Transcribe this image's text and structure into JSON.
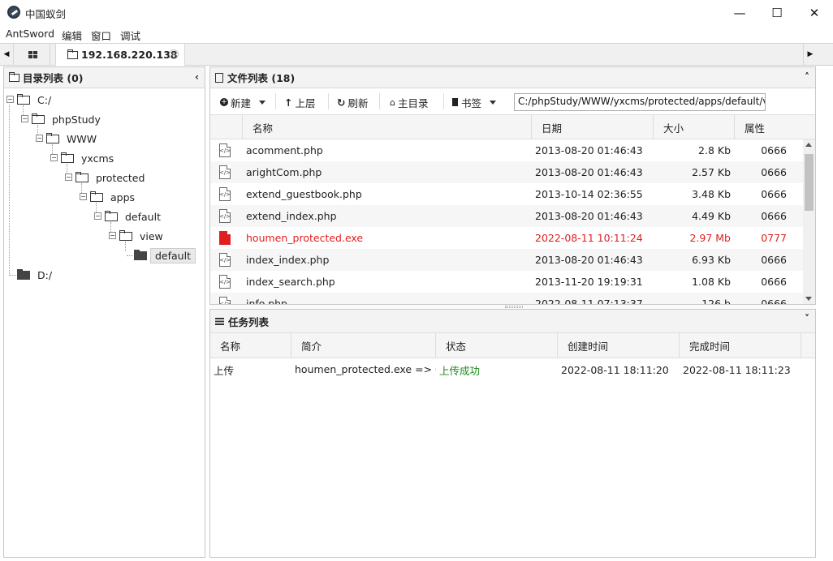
{
  "window": {
    "title": "中国蚁剑",
    "minimize_glyph": "—",
    "maximize_glyph": "☐",
    "close_glyph": "✕"
  },
  "menu": [
    "AntSword",
    "编辑",
    "窗口",
    "调试"
  ],
  "tabs": {
    "left_arrow": "◀",
    "right_arrow": "▶",
    "host_label": "192.168.220.138",
    "close_glyph": "✕"
  },
  "dir_panel": {
    "title": "目录列表 (0)",
    "collapse_glyph": "‹",
    "tree": [
      {
        "label": "C:/",
        "depth": 0,
        "toggle": "−",
        "filled": false,
        "selected": false
      },
      {
        "label": "phpStudy",
        "depth": 1,
        "toggle": "−",
        "filled": false,
        "selected": false
      },
      {
        "label": "WWW",
        "depth": 2,
        "toggle": "−",
        "filled": false,
        "selected": false
      },
      {
        "label": "yxcms",
        "depth": 3,
        "toggle": "−",
        "filled": false,
        "selected": false
      },
      {
        "label": "protected",
        "depth": 4,
        "toggle": "−",
        "filled": false,
        "selected": false
      },
      {
        "label": "apps",
        "depth": 5,
        "toggle": "−",
        "filled": false,
        "selected": false
      },
      {
        "label": "default",
        "depth": 6,
        "toggle": "−",
        "filled": false,
        "selected": false
      },
      {
        "label": "view",
        "depth": 7,
        "toggle": "−",
        "filled": false,
        "selected": false
      },
      {
        "label": "default",
        "depth": 8,
        "toggle": "",
        "filled": true,
        "selected": true
      },
      {
        "label": "D:/",
        "depth": 0,
        "toggle": "",
        "filled": true,
        "selected": false
      }
    ]
  },
  "file_panel": {
    "title": "文件列表 (18)",
    "collapse_glyph": "˄",
    "toolbar": {
      "new_label": "新建",
      "up_label": "上层",
      "refresh_label": "刷新",
      "home_label": "主目录",
      "bookmark_label": "书签",
      "path_value": "C:/phpStudy/WWW/yxcms/protected/apps/default/view/"
    },
    "columns": [
      "名称",
      "日期",
      "大小",
      "属性"
    ],
    "files": [
      {
        "name": "acomment.php",
        "date": "2013-08-20 01:46:43",
        "size": "2.8 Kb",
        "attr": "0666",
        "type": "php"
      },
      {
        "name": "arightCom.php",
        "date": "2013-08-20 01:46:43",
        "size": "2.57 Kb",
        "attr": "0666",
        "type": "php"
      },
      {
        "name": "extend_guestbook.php",
        "date": "2013-10-14 02:36:55",
        "size": "3.48 Kb",
        "attr": "0666",
        "type": "php"
      },
      {
        "name": "extend_index.php",
        "date": "2013-08-20 01:46:43",
        "size": "4.49 Kb",
        "attr": "0666",
        "type": "php"
      },
      {
        "name": "houmen_protected.exe",
        "date": "2022-08-11 10:11:24",
        "size": "2.97 Mb",
        "attr": "0777",
        "type": "exe"
      },
      {
        "name": "index_index.php",
        "date": "2013-08-20 01:46:43",
        "size": "6.93 Kb",
        "attr": "0666",
        "type": "php"
      },
      {
        "name": "index_search.php",
        "date": "2013-11-20 19:19:31",
        "size": "1.08 Kb",
        "attr": "0666",
        "type": "php"
      },
      {
        "name": "info.php",
        "date": "2022-08-11 07:13:37",
        "size": "126 b",
        "attr": "0666",
        "type": "php"
      }
    ]
  },
  "task_panel": {
    "title": "任务列表",
    "collapse_glyph": "˅",
    "columns": [
      "名称",
      "简介",
      "状态",
      "创建时间",
      "完成时间"
    ],
    "tasks": [
      {
        "name": "上传",
        "desc": "houmen_protected.exe => C:/phpStudy/WWW/yxcms/protected/apps/default/view/",
        "status": "上传成功",
        "created": "2022-08-11 18:11:20",
        "finished": "2022-08-11 18:11:23"
      }
    ]
  },
  "colors": {
    "highlight_red": "#e02020",
    "success_green": "#1a8a1a"
  }
}
